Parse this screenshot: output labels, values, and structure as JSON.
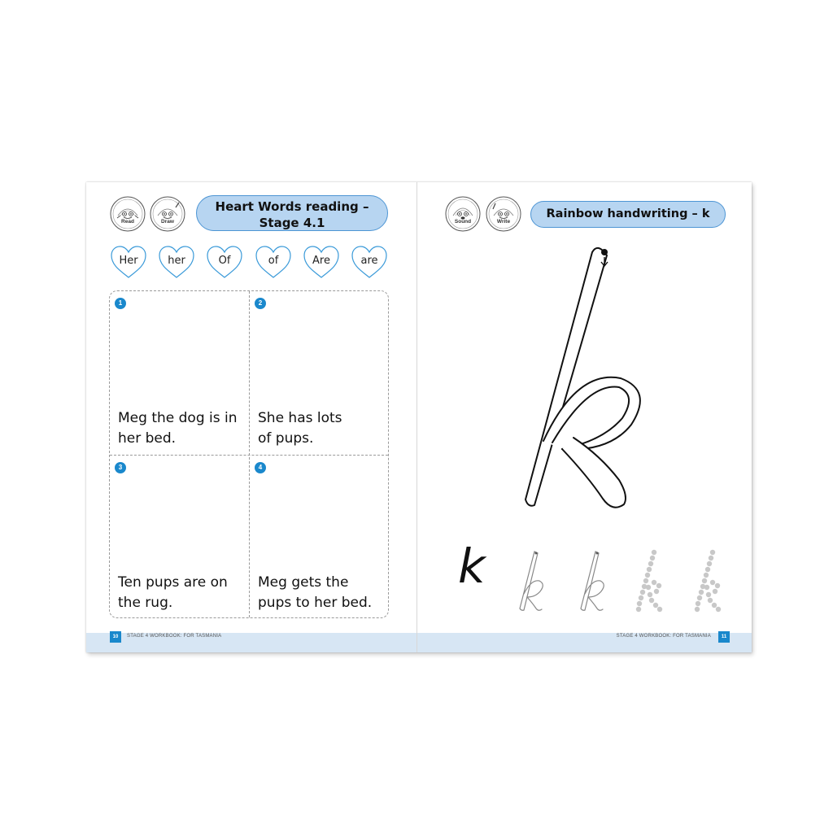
{
  "left_page": {
    "badges": [
      {
        "label": "Read",
        "icon": "reading-character-icon"
      },
      {
        "label": "Draw",
        "icon": "drawing-character-icon"
      }
    ],
    "title_line1": "Heart Words reading –",
    "title_line2": "Stage 4.1",
    "heart_words": [
      "Her",
      "her",
      "Of",
      "of",
      "Are",
      "are"
    ],
    "panels": [
      {
        "number": "1",
        "line1": "Meg the dog is in",
        "line2": "her bed."
      },
      {
        "number": "2",
        "line1": "She has lots",
        "line2": "of pups."
      },
      {
        "number": "3",
        "line1": "Ten pups are on",
        "line2": "the rug."
      },
      {
        "number": "4",
        "line1": "Meg gets the",
        "line2": "pups to her bed."
      }
    ],
    "page_number": "10",
    "footer": "STAGE 4 WORKBOOK: FOR TASMANIA"
  },
  "right_page": {
    "badges": [
      {
        "label": "Sound",
        "icon": "sound-character-icon"
      },
      {
        "label": "Write",
        "icon": "writing-character-icon"
      }
    ],
    "title": "Rainbow handwriting – ",
    "title_letter": "k",
    "practice_letter": "k",
    "page_number": "11",
    "footer": "STAGE 4 WORKBOOK: FOR TASMANIA"
  },
  "colors": {
    "accent_blue": "#1a88cc",
    "pill_fill": "#b7d5f1",
    "pill_border": "#4d95d4",
    "footer_band": "#d7e6f4",
    "heart_outline": "#3a9ad9"
  }
}
